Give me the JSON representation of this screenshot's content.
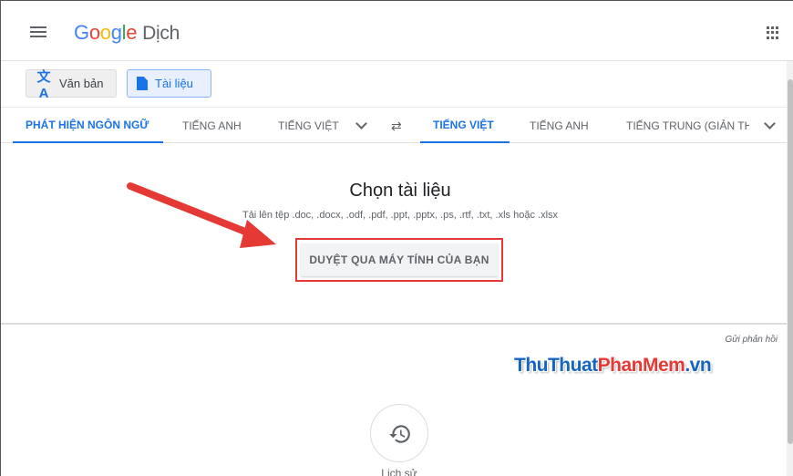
{
  "header": {
    "logo_parts": [
      "G",
      "o",
      "o",
      "g",
      "l",
      "e"
    ],
    "product": "Dịch"
  },
  "modes": {
    "text_label": "Văn bản",
    "doc_label": "Tài liệu"
  },
  "source_langs": [
    "PHÁT HIỆN NGÔN NGỮ",
    "TIẾNG ANH",
    "TIẾNG VIỆT"
  ],
  "target_langs": [
    "TIẾNG VIỆT",
    "TIẾNG ANH",
    "TIẾNG TRUNG (GIẢN TH"
  ],
  "upload": {
    "title": "Chọn tài liệu",
    "subtitle": "Tải lên tệp .doc, .docx, .odf, .pdf, .ppt, .pptx, .ps, .rtf, .txt, .xls hoặc .xlsx",
    "browse_label": "DUYỆT QUA MÁY TÍNH CỦA BẠN"
  },
  "feedback_label": "Gửi phản hồi",
  "watermark": {
    "part1": "ThuThuat",
    "part2": "PhanMem",
    "part3": ".vn"
  },
  "history_label": "Lịch sử",
  "colors": {
    "accent": "#1a73e8",
    "annotation_red": "#e53935"
  },
  "icons": [
    "menu-icon",
    "apps-grid-icon",
    "translate-icon",
    "document-icon",
    "chevron-down-icon",
    "swap-icon",
    "history-icon",
    "annotation-arrow-icon"
  ]
}
